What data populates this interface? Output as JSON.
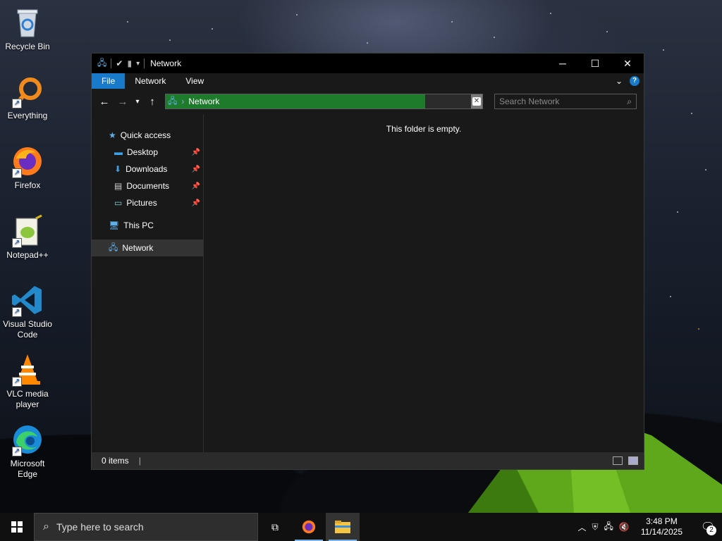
{
  "desktop": {
    "icons": [
      {
        "label": "Recycle Bin",
        "icon": "recycle-bin-icon"
      },
      {
        "label": "Everything",
        "icon": "everything-search-icon"
      },
      {
        "label": "Firefox",
        "icon": "firefox-icon"
      },
      {
        "label": "Notepad++",
        "icon": "notepad-plus-plus-icon"
      },
      {
        "label": "Visual Studio Code",
        "icon": "vscode-icon"
      },
      {
        "label": "VLC media player",
        "icon": "vlc-icon"
      },
      {
        "label": "Microsoft Edge",
        "icon": "edge-icon"
      }
    ]
  },
  "window": {
    "title": "Network",
    "controls": {
      "minimize": "─",
      "maximize": "☐",
      "close": "✕"
    },
    "ribbon": {
      "tabs": [
        "File",
        "Network",
        "View"
      ],
      "help": "?"
    },
    "address": {
      "crumb": "Network",
      "separator": "›"
    },
    "search": {
      "placeholder": "Search Network"
    },
    "nav": {
      "quick_access": "Quick access",
      "pinned": [
        "Desktop",
        "Downloads",
        "Documents",
        "Pictures"
      ],
      "this_pc": "This PC",
      "network": "Network"
    },
    "content": {
      "empty_message": "This folder is empty."
    },
    "status": {
      "items": "0 items",
      "cursor": "|"
    }
  },
  "taskbar": {
    "search_placeholder": "Type here to search",
    "clock": {
      "time": "3:48 PM",
      "date": "11/14/2025"
    },
    "notification_count": "2"
  },
  "colors": {
    "accent": "#1979ca",
    "address_highlight": "#1e7b2c",
    "window_bg": "#191919"
  }
}
